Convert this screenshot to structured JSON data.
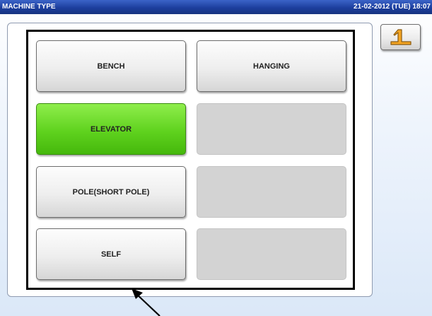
{
  "titlebar": {
    "title": "MACHINE TYPE",
    "datetime": "21-02-2012 (TUE) 18:07"
  },
  "back_button": {
    "icon": "return-arrow-icon",
    "accent": "#f5a623"
  },
  "keys": [
    {
      "label": "BENCH",
      "state": "normal"
    },
    {
      "label": "HANGING",
      "state": "normal"
    },
    {
      "label": "ELEVATOR",
      "state": "selected"
    },
    {
      "label": "",
      "state": "empty"
    },
    {
      "label": "POLE(SHORT POLE)",
      "state": "normal"
    },
    {
      "label": "",
      "state": "empty"
    },
    {
      "label": "SELF",
      "state": "normal"
    },
    {
      "label": "",
      "state": "empty"
    }
  ],
  "colors": {
    "titlebar": "#1d3f9e",
    "selected": "#5fd21e",
    "empty": "#d3d3d3"
  }
}
